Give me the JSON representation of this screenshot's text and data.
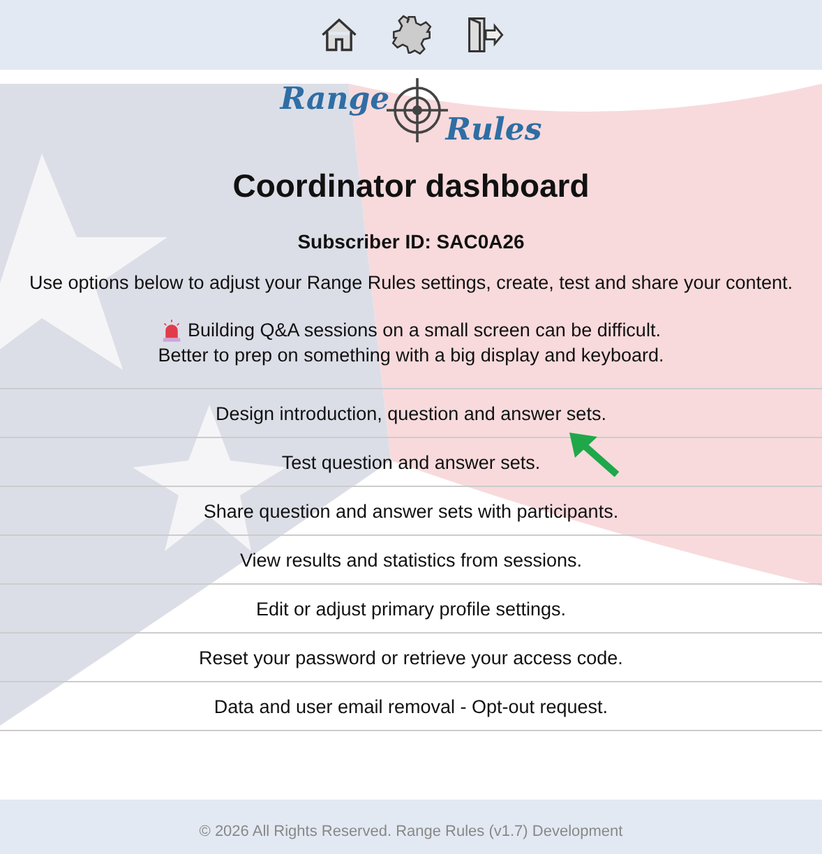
{
  "nav": {
    "icons": [
      {
        "kind": "home"
      },
      {
        "kind": "settings"
      },
      {
        "kind": "logout"
      }
    ]
  },
  "logo": {
    "word_1": "Range",
    "word_2": "Rules"
  },
  "title": "Coordinator dashboard",
  "subscriber": "Subscriber ID: SAC0A26",
  "intro": "Use options below to adjust your Range Rules settings, create, test and share your content.",
  "notice": {
    "line_1": "Building Q&A sessions on a small screen can be difficult.",
    "line_2": "Better to prep on something with a big display and keyboard."
  },
  "menu": [
    {
      "label": "Design introduction, question and answer sets."
    },
    {
      "label": "Test question and answer sets."
    },
    {
      "label": "Share question and answer sets with participants."
    },
    {
      "label": "View results and statistics from sessions."
    },
    {
      "label": "Edit or adjust primary profile settings."
    },
    {
      "label": "Reset your password or retrieve your access code."
    },
    {
      "label": "Data and user email removal - Opt-out request."
    }
  ],
  "footer": {
    "copyright": "© 2026 All Rights Reserved. Range Rules (v1.7) Development"
  }
}
